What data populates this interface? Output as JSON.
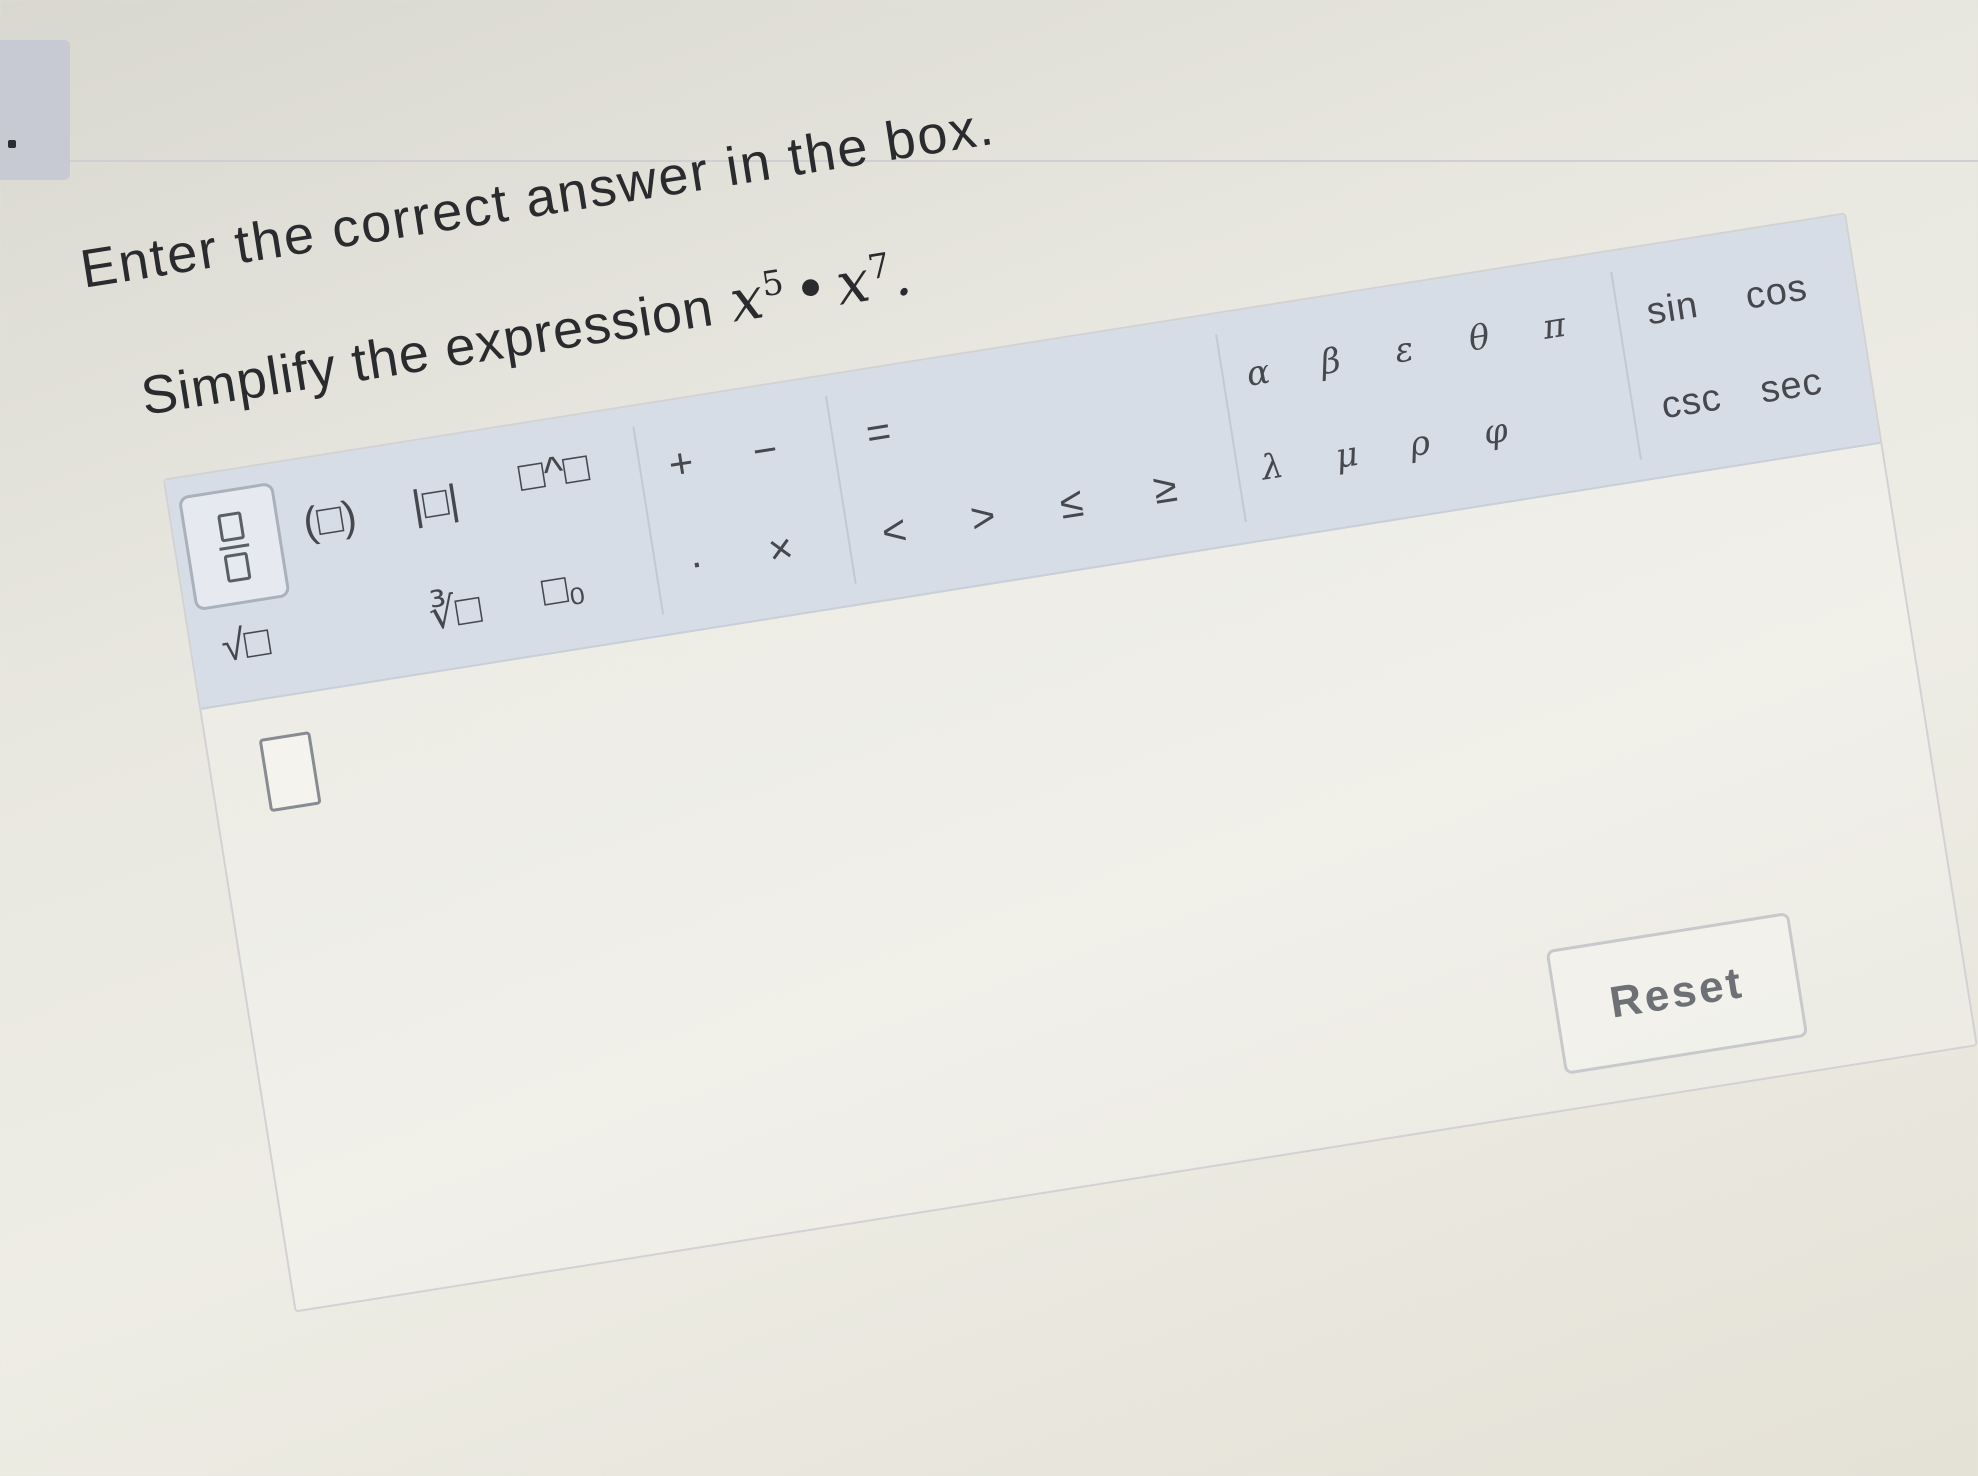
{
  "instruction": "Enter the correct answer in the box.",
  "question": {
    "prompt": "Simplify the expression",
    "base1": "x",
    "exp1": "5",
    "operator": "•",
    "base2": "x",
    "exp2": "7",
    "end": "."
  },
  "toolbar": {
    "structures": {
      "fraction": "fraction",
      "parentheses": "(□)",
      "absolute": "|□|",
      "power": "□^□",
      "sqrt": "√□",
      "nth_root": "∛□",
      "subscript": "□₀"
    },
    "operators": {
      "plus": "+",
      "minus": "−",
      "dot": "·",
      "times": "×",
      "equals": "=",
      "less": "<",
      "greater": ">",
      "leq": "≤",
      "geq": "≥"
    },
    "greek": {
      "alpha": "α",
      "beta": "β",
      "epsilon": "ε",
      "theta": "θ",
      "pi": "π",
      "lambda": "λ",
      "mu": "μ",
      "rho": "ρ",
      "phi": "φ"
    },
    "trig": {
      "sin": "sin",
      "cos": "cos",
      "csc": "csc",
      "sec": "sec"
    }
  },
  "answer": {
    "value": ""
  },
  "reset_label": "Reset"
}
